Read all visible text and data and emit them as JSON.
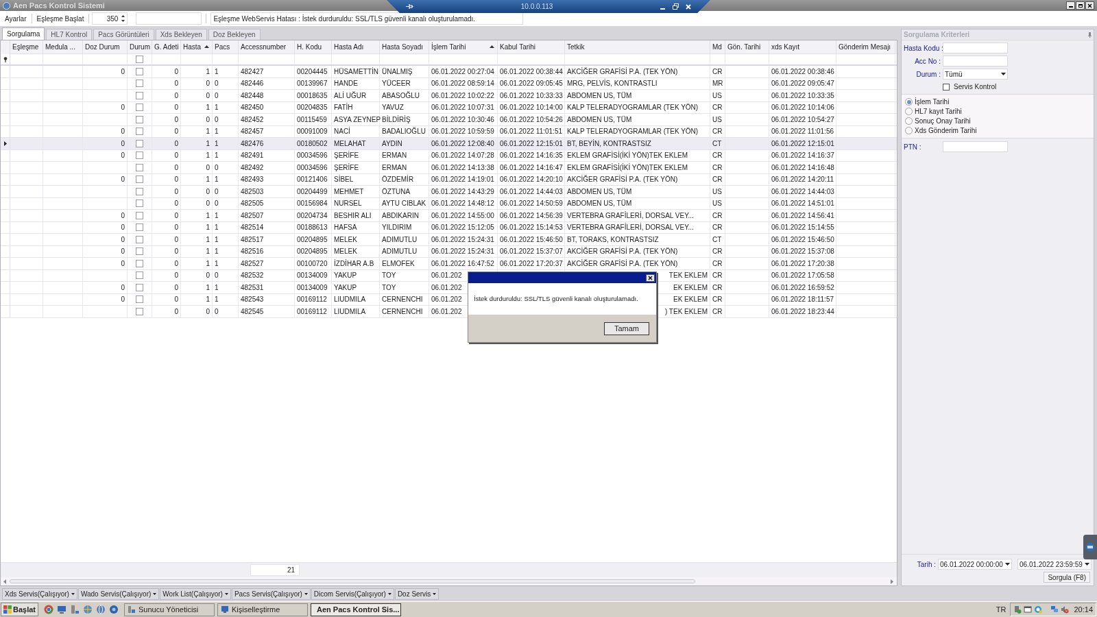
{
  "window": {
    "title": "Aen Pacs Kontrol Sistemi"
  },
  "remote_bar": {
    "title": "10.0.0.113"
  },
  "toolbar": {
    "items": [
      "Ayarlar",
      "Eşleşme Başlat"
    ],
    "spinner_value": "350",
    "message": "Eşleşme WebServis Hatası : İstek durduruldu: SSL/TLS güvenli kanalı oluşturulamadı."
  },
  "tabs": [
    {
      "label": "Sorgulama",
      "selected": true
    },
    {
      "label": "HL7 Kontrol",
      "selected": false
    },
    {
      "label": "Pacs Görüntüleri",
      "selected": false
    },
    {
      "label": "Xds Bekleyen",
      "selected": false
    },
    {
      "label": "Doz Bekleyen",
      "selected": false
    }
  ],
  "table": {
    "columns": [
      {
        "label": "Eşleşme",
        "kind": "text",
        "sorted": false
      },
      {
        "label": "Medula ...",
        "kind": "text",
        "sorted": false
      },
      {
        "label": "Doz Durum",
        "kind": "number",
        "sorted": false
      },
      {
        "label": "Durum",
        "kind": "check",
        "sorted": false
      },
      {
        "label": "G. Adeti",
        "kind": "number",
        "sorted": false
      },
      {
        "label": "Hasta",
        "kind": "number",
        "sorted": true
      },
      {
        "label": "Pacs",
        "kind": "text",
        "sorted": false
      },
      {
        "label": "Accessnumber",
        "kind": "text",
        "sorted": false
      },
      {
        "label": "H. Kodu",
        "kind": "text",
        "sorted": false
      },
      {
        "label": "Hasta Adı",
        "kind": "text",
        "sorted": false
      },
      {
        "label": "Hasta Soyadı",
        "kind": "text",
        "sorted": false
      },
      {
        "label": "İşlem Tarihi",
        "kind": "text",
        "sorted": true
      },
      {
        "label": "Kabul Tarihi",
        "kind": "text",
        "sorted": false
      },
      {
        "label": "Tetkik",
        "kind": "text",
        "sorted": false
      },
      {
        "label": "Md",
        "kind": "text",
        "sorted": false
      },
      {
        "label": "Gön. Tarihi",
        "kind": "text",
        "sorted": false
      },
      {
        "label": "xds Kayıt",
        "kind": "text",
        "sorted": false
      },
      {
        "label": "Gönderim Mesajı",
        "kind": "text",
        "sorted": false
      }
    ],
    "filter_row": {
      "durum_checked": false
    },
    "rows": [
      {
        "selected": false,
        "clipped": false,
        "durum_checked": false,
        "doz": "0",
        "g_adeti": "0",
        "hasta": "1",
        "pacs": "1",
        "acc": "482427",
        "h_kodu": "00204445",
        "adi": "HÜSAMETTİN",
        "soyadi": "ÜNALMIŞ",
        "islem": "06.01.2022 00:27:04",
        "kabul": "06.01.2022 00:38:44",
        "tetkik": "AKCİĞER GRAFİSİ P.A. (TEK YÖN)",
        "md": "CR",
        "xds": "06.01.2022 00:38:46"
      },
      {
        "selected": false,
        "clipped": false,
        "durum_checked": false,
        "g_adeti": "0",
        "hasta": "0",
        "pacs": "0",
        "acc": "482446",
        "h_kodu": "00139967",
        "adi": "HANDE",
        "soyadi": "YÜCEER",
        "islem": "06.01.2022 08:59:14",
        "kabul": "06.01.2022 09:05:45",
        "tetkik": "MRG, PELVİS, KONTRASTLI",
        "md": "MR",
        "xds": "06.01.2022 09:05:47"
      },
      {
        "selected": false,
        "clipped": false,
        "durum_checked": false,
        "g_adeti": "0",
        "hasta": "0",
        "pacs": "0",
        "acc": "482448",
        "h_kodu": "00018635",
        "adi": "ALİ UĞUR",
        "soyadi": "ABASOĞLU",
        "islem": "06.01.2022 10:02:22",
        "kabul": "06.01.2022 10:33:33",
        "tetkik": "ABDOMEN US, TÜM",
        "md": "US",
        "xds": "06.01.2022 10:33:35"
      },
      {
        "selected": false,
        "clipped": false,
        "durum_checked": false,
        "doz": "0",
        "g_adeti": "0",
        "hasta": "1",
        "pacs": "1",
        "acc": "482450",
        "h_kodu": "00204835",
        "adi": "FATİH",
        "soyadi": "YAVUZ",
        "islem": "06.01.2022 10:07:31",
        "kabul": "06.01.2022 10:14:00",
        "tetkik": "KALP TELERADYOGRAMLAR (TEK YÖN)",
        "md": "CR",
        "xds": "06.01.2022 10:14:06"
      },
      {
        "selected": false,
        "clipped": false,
        "durum_checked": false,
        "g_adeti": "0",
        "hasta": "0",
        "pacs": "0",
        "acc": "482452",
        "h_kodu": "00115459",
        "adi": "ASYA ZEYNEP",
        "soyadi": "BİLDİRİŞ",
        "islem": "06.01.2022 10:30:46",
        "kabul": "06.01.2022 10:54:26",
        "tetkik": "ABDOMEN US, TÜM",
        "md": "US",
        "xds": "06.01.2022 10:54:27"
      },
      {
        "selected": false,
        "clipped": false,
        "durum_checked": false,
        "doz": "0",
        "g_adeti": "0",
        "hasta": "1",
        "pacs": "1",
        "acc": "482457",
        "h_kodu": "00091009",
        "adi": "NACİ",
        "soyadi": "BADALIOĞLU",
        "islem": "06.01.2022 10:59:59",
        "kabul": "06.01.2022 11:01:51",
        "tetkik": "KALP TELERADYOGRAMLAR (TEK YÖN)",
        "md": "CR",
        "xds": "06.01.2022 11:01:56"
      },
      {
        "selected": true,
        "clipped": false,
        "durum_checked": false,
        "doz": "0",
        "g_adeti": "0",
        "hasta": "1",
        "pacs": "1",
        "acc": "482476",
        "h_kodu": "00180502",
        "adi": "MELAHAT",
        "soyadi": "AYDIN",
        "islem": "06.01.2022 12:08:40",
        "kabul": "06.01.2022 12:15:01",
        "tetkik": "BT, BEYİN, KONTRASTSIZ",
        "md": "CT",
        "xds": "06.01.2022 12:15:01"
      },
      {
        "selected": false,
        "clipped": false,
        "durum_checked": false,
        "doz": "0",
        "g_adeti": "0",
        "hasta": "1",
        "pacs": "1",
        "acc": "482491",
        "h_kodu": "00034596",
        "adi": "ŞERİFE",
        "soyadi": "ERMAN",
        "islem": "06.01.2022 14:07:28",
        "kabul": "06.01.2022 14:16:35",
        "tetkik": "EKLEM GRAFİSİ(İKİ YÖN)TEK EKLEM",
        "md": "CR",
        "xds": "06.01.2022 14:16:37"
      },
      {
        "selected": false,
        "clipped": false,
        "durum_checked": false,
        "g_adeti": "0",
        "hasta": "0",
        "pacs": "0",
        "acc": "482492",
        "h_kodu": "00034596",
        "adi": "ŞERİFE",
        "soyadi": "ERMAN",
        "islem": "06.01.2022 14:13:38",
        "kabul": "06.01.2022 14:16:47",
        "tetkik": "EKLEM GRAFİSİ(İKİ YÖN)TEK EKLEM",
        "md": "CR",
        "xds": "06.01.2022 14:16:48"
      },
      {
        "selected": false,
        "clipped": false,
        "durum_checked": false,
        "doz": "0",
        "g_adeti": "0",
        "hasta": "1",
        "pacs": "1",
        "acc": "482493",
        "h_kodu": "00121406",
        "adi": "SİBEL",
        "soyadi": "ÖZDEMİR",
        "islem": "06.01.2022 14:19:01",
        "kabul": "06.01.2022 14:20:10",
        "tetkik": "AKCİĞER GRAFİSİ P.A. (TEK YÖN)",
        "md": "CR",
        "xds": "06.01.2022 14:20:11"
      },
      {
        "selected": false,
        "clipped": false,
        "durum_checked": false,
        "g_adeti": "0",
        "hasta": "0",
        "pacs": "0",
        "acc": "482503",
        "h_kodu": "00204499",
        "adi": "MEHMET",
        "soyadi": "ÖZTUNA",
        "islem": "06.01.2022 14:43:29",
        "kabul": "06.01.2022 14:44:03",
        "tetkik": "ABDOMEN US, TÜM",
        "md": "US",
        "xds": "06.01.2022 14:44:03"
      },
      {
        "selected": false,
        "clipped": false,
        "durum_checked": false,
        "g_adeti": "0",
        "hasta": "0",
        "pacs": "0",
        "acc": "482505",
        "h_kodu": "00156984",
        "adi": "NURSEL",
        "soyadi": "AYTU CIBLAK",
        "islem": "06.01.2022 14:48:12",
        "kabul": "06.01.2022 14:50:59",
        "tetkik": "ABDOMEN US, TÜM",
        "md": "US",
        "xds": "06.01.2022 14:51:01"
      },
      {
        "selected": false,
        "clipped": false,
        "durum_checked": false,
        "doz": "0",
        "g_adeti": "0",
        "hasta": "1",
        "pacs": "1",
        "acc": "482507",
        "h_kodu": "00204734",
        "adi": "BESHIR ALI",
        "soyadi": "ABDIKARIN",
        "islem": "06.01.2022 14:55:00",
        "kabul": "06.01.2022 14:56:39",
        "tetkik": "VERTEBRA GRAFİLERİ, DORSAL VEY...",
        "md": "CR",
        "xds": "06.01.2022 14:56:41"
      },
      {
        "selected": false,
        "clipped": false,
        "durum_checked": false,
        "doz": "0",
        "g_adeti": "0",
        "hasta": "1",
        "pacs": "1",
        "acc": "482514",
        "h_kodu": "00188613",
        "adi": "HAFSA",
        "soyadi": "YILDIRIM",
        "islem": "06.01.2022 15:12:05",
        "kabul": "06.01.2022 15:14:53",
        "tetkik": "VERTEBRA GRAFİLERİ, DORSAL VEY...",
        "md": "CR",
        "xds": "06.01.2022 15:14:55"
      },
      {
        "selected": false,
        "clipped": false,
        "durum_checked": false,
        "doz": "0",
        "g_adeti": "0",
        "hasta": "1",
        "pacs": "1",
        "acc": "482517",
        "h_kodu": "00204895",
        "adi": "MELEK",
        "soyadi": "ADIMUTLU",
        "islem": "06.01.2022 15:24:31",
        "kabul": "06.01.2022 15:46:50",
        "tetkik": "BT, TORAKS, KONTRASTSIZ",
        "md": "CT",
        "xds": "06.01.2022 15:46:50"
      },
      {
        "selected": false,
        "clipped": false,
        "durum_checked": false,
        "doz": "0",
        "g_adeti": "0",
        "hasta": "1",
        "pacs": "1",
        "acc": "482516",
        "h_kodu": "00204895",
        "adi": "MELEK",
        "soyadi": "ADIMUTLU",
        "islem": "06.01.2022 15:24:31",
        "kabul": "06.01.2022 15:37:07",
        "tetkik": "AKCİĞER GRAFİSİ P.A. (TEK YÖN)",
        "md": "CR",
        "xds": "06.01.2022 15:37:08"
      },
      {
        "selected": false,
        "clipped": false,
        "durum_checked": false,
        "doz": "0",
        "g_adeti": "0",
        "hasta": "1",
        "pacs": "1",
        "acc": "482527",
        "h_kodu": "00100720",
        "adi": "İZDİHAR A.B",
        "soyadi": "ELMOFEK",
        "islem": "06.01.2022 16:47:52",
        "kabul": "06.01.2022 17:20:37",
        "tetkik": "AKCİĞER GRAFİSİ P.A. (TEK YÖN)",
        "md": "CR",
        "xds": "06.01.2022 17:20:38"
      },
      {
        "selected": false,
        "clipped": true,
        "durum_checked": false,
        "g_adeti": "0",
        "hasta": "0",
        "pacs": "0",
        "acc": "482532",
        "h_kodu": "00134009",
        "adi": "YAKUP",
        "soyadi": "TOY",
        "islem": "06.01.202",
        "tetkik": "TEK EKLEM",
        "md": "CR",
        "xds": "06.01.2022 17:05:58"
      },
      {
        "selected": false,
        "clipped": true,
        "durum_checked": false,
        "doz": "0",
        "g_adeti": "0",
        "hasta": "1",
        "pacs": "1",
        "acc": "482531",
        "h_kodu": "00134009",
        "adi": "YAKUP",
        "soyadi": "TOY",
        "islem": "06.01.202",
        "tetkik": "EK EKLEM",
        "md": "CR",
        "xds": "06.01.2022 16:59:52"
      },
      {
        "selected": false,
        "clipped": true,
        "durum_checked": false,
        "doz": "0",
        "g_adeti": "0",
        "hasta": "1",
        "pacs": "1",
        "acc": "482543",
        "h_kodu": "00169112",
        "adi": "LIUDMILA",
        "soyadi": "CERNENCHI",
        "islem": "06.01.202",
        "tetkik": "EK EKLEM",
        "md": "CR",
        "xds": "06.01.2022 18:11:57"
      },
      {
        "selected": false,
        "clipped": true,
        "durum_checked": false,
        "g_adeti": "0",
        "hasta": "0",
        "pacs": "0",
        "acc": "482545",
        "h_kodu": "00169112",
        "adi": "LIUDMILA",
        "soyadi": "CERNENCHI",
        "islem": "06.01.202",
        "tetkik": ") TEK EKLEM",
        "md": "CR",
        "xds": "06.01.2022 18:23:44"
      }
    ],
    "footer_count": "21"
  },
  "criteria_panel": {
    "title": "Sorgulama Kriterleri",
    "hasta_kodu_label": "Hasta Kodu :",
    "acc_no_label": "Acc No :",
    "durum_label": "Durum :",
    "durum_value": "Tümü",
    "servis_kontrol": {
      "label": "Servis Kontrol",
      "checked": false
    },
    "date_options": [
      {
        "label": "İşlem Tarihi",
        "selected": true
      },
      {
        "label": "HL7 kayıt Tarihi",
        "selected": false
      },
      {
        "label": "Sonuç Onay Tarihi",
        "selected": false
      },
      {
        "label": "Xds Gönderim Tarihi",
        "selected": false
      }
    ],
    "ptn_label": "PTN  :",
    "tarih_label": "Tarih :",
    "date_from": "06.01.2022 00:00:00",
    "date_to": "06.01.2022 23:59:59",
    "query_button": "Sorgula (F8)"
  },
  "dialog": {
    "message": "İstek durduruldu: SSL/TLS güvenli kanalı oluşturulamadı.",
    "button": "Tamam"
  },
  "status_strip": [
    "Xds Servis(Çalışıyor)",
    "Wado Servis(Çalışıyor)",
    "Work List(Çalışıyor)",
    "Pacs Servis(Çalışıyor)",
    "Dicom Servis(Çalışıyor)",
    "Doz Servis"
  ],
  "taskbar": {
    "start": "Başlat",
    "tasks": [
      {
        "label": "Sunucu Yöneticisi",
        "selected": false
      },
      {
        "label": "Kişiselleştirme",
        "selected": false
      },
      {
        "label": "Aen Pacs Kontrol Sis...",
        "selected": true
      }
    ],
    "language": "TR",
    "clock": "20:14"
  }
}
